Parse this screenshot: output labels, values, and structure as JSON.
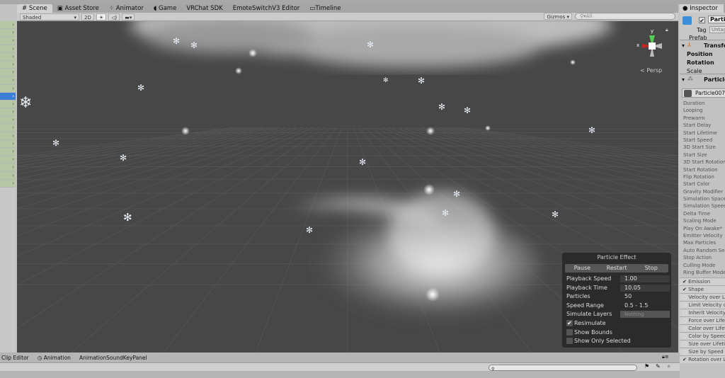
{
  "tabs": [
    {
      "label": "Scene",
      "icon": "grid-icon",
      "active": true
    },
    {
      "label": "Asset Store",
      "icon": "store-icon"
    },
    {
      "label": "Animator",
      "icon": "animator-icon"
    },
    {
      "label": "Game",
      "icon": "pacman-icon"
    },
    {
      "label": "VRChat SDK"
    },
    {
      "label": "EmoteSwitchV3 Editor"
    },
    {
      "label": "Timeline",
      "icon": "timeline-icon"
    }
  ],
  "toolbar": {
    "shading": "Shaded",
    "mode_2d": "2D",
    "gizmos": "Gizmos",
    "search_placeholder": "All"
  },
  "scene": {
    "view_label": "Persp",
    "axis_x": "x",
    "axis_y": "y"
  },
  "particle_effect": {
    "title": "Particle Effect",
    "pause": "Pause",
    "restart": "Restart",
    "stop": "Stop",
    "rows": [
      {
        "label": "Playback Speed",
        "value": "1.00"
      },
      {
        "label": "Playback Time",
        "value": "10.05"
      },
      {
        "label": "Particles",
        "value": "50"
      },
      {
        "label": "Speed Range",
        "value": "0.5 - 1.5"
      },
      {
        "label": "Simulate Layers",
        "value": "Nothing"
      }
    ],
    "checks": [
      {
        "label": "Resimulate",
        "checked": true
      },
      {
        "label": "Show Bounds",
        "checked": false
      },
      {
        "label": "Show Only Selected",
        "checked": false
      }
    ]
  },
  "inspector": {
    "tab": "Inspector",
    "object_name": "Parti",
    "tag_label": "Tag",
    "tag_value": "Untag",
    "prefab_label": "Prefab",
    "transform": "Transfo",
    "position": "Position",
    "rotation": "Rotation",
    "scale": "Scale",
    "particle_component": "Particle",
    "particle_name": "Particle007",
    "props": [
      "Duration",
      "Looping",
      "Prewarm",
      "Start Delay",
      "Start Lifetime",
      "Start Speed",
      "3D Start Size",
      "Start Size",
      "3D Start Rotation",
      "Start Rotation",
      "Flip Rotation",
      "Start Color",
      "Gravity Modifier",
      "Simulation Space",
      "Simulation Speed",
      "Delta Time",
      "Scaling Mode",
      "Play On Awake*",
      "Emitter Velocity",
      "Max Particles",
      "Auto Random Seed",
      "Stop Action",
      "Culling Mode",
      "Ring Buffer Mode"
    ],
    "modules": [
      {
        "label": "Emission",
        "enabled": true
      },
      {
        "label": "Shape",
        "enabled": true
      },
      {
        "label": "Velocity over L",
        "enabled": false
      },
      {
        "label": "Limit Velocity o",
        "enabled": false
      },
      {
        "label": "Inherit Velocity",
        "enabled": false
      },
      {
        "label": "Force over Lifet",
        "enabled": false
      },
      {
        "label": "Color over Lifet",
        "enabled": false
      },
      {
        "label": "Color by Speed",
        "enabled": false
      },
      {
        "label": "Size over Lifeti",
        "enabled": false
      },
      {
        "label": "Size by Speed",
        "enabled": false
      },
      {
        "label": "Rotation over L",
        "enabled": true
      }
    ]
  },
  "bottom": {
    "tabs": [
      "Clip Editor",
      "Animation",
      "AnimationSoundKeyPanel"
    ]
  }
}
